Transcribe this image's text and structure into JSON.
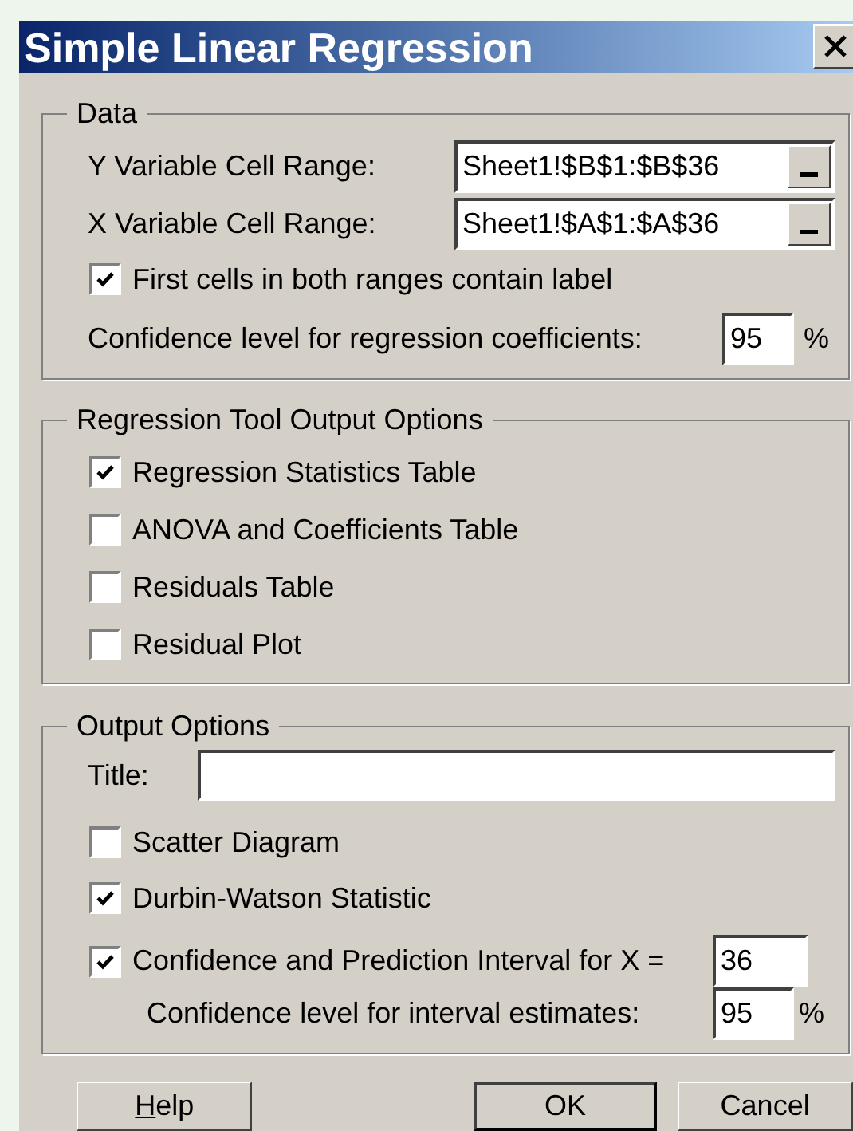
{
  "window": {
    "title": "Simple Linear Regression"
  },
  "data_group": {
    "label": "Data",
    "ranges": [
      {
        "label": "Y Variable Cell Range:",
        "value": "Sheet1!$B$1:$B$36"
      },
      {
        "label": "X Variable Cell Range:",
        "value": "Sheet1!$A$1:$A$36"
      }
    ],
    "labels_option": {
      "label": "First cells in both ranges contain label",
      "checked": true
    },
    "confidence": {
      "label": "Confidence level for regression coefficients:",
      "value": "95",
      "unit": "%"
    }
  },
  "regression_group": {
    "label": "Regression Tool Output Options",
    "options": [
      {
        "label": "Regression Statistics Table",
        "checked": true
      },
      {
        "label": "ANOVA and Coefficients Table",
        "checked": false
      },
      {
        "label": "Residuals Table",
        "checked": false
      },
      {
        "label": "Residual Plot",
        "checked": false
      }
    ]
  },
  "output_group": {
    "label": "Output Options",
    "title_field": {
      "label": "Title:"
    },
    "options": [
      {
        "label": "Scatter Diagram",
        "checked": false
      },
      {
        "label": "Durbin-Watson Statistic",
        "checked": true
      },
      {
        "label": "Confidence and Prediction Interval for X =",
        "checked": true,
        "value": "36"
      }
    ],
    "interval_confidence": {
      "label": "Confidence level for interval estimates:",
      "value": "95",
      "unit": "%"
    }
  },
  "buttons": [
    {
      "label": "Help",
      "underline_first": true,
      "default": false
    },
    {
      "label": "OK",
      "underline_first": false,
      "default": true
    },
    {
      "label": "Cancel",
      "underline_first": false,
      "default": false
    }
  ]
}
